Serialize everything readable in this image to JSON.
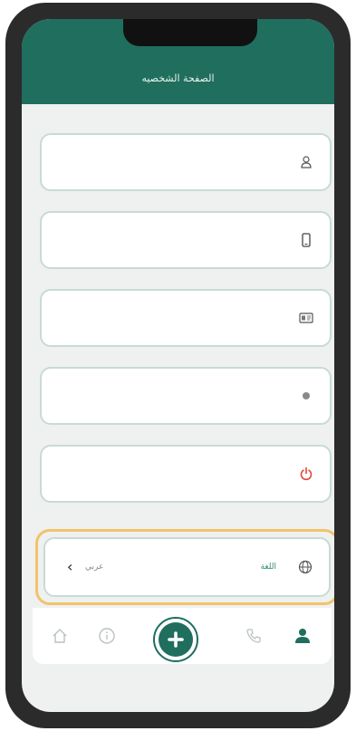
{
  "header": {
    "title": "الصفحة الشخصيه"
  },
  "fields": [
    {
      "icon": "user-icon"
    },
    {
      "icon": "phone-icon"
    },
    {
      "icon": "id-card-icon"
    },
    {
      "icon": "info-dot-icon"
    },
    {
      "icon": "power-icon"
    }
  ],
  "language": {
    "label": "اللغة",
    "value": "عربي",
    "icon": "globe-icon",
    "highlight_color": "#f2c36b"
  },
  "nav": {
    "items": [
      "home-icon",
      "info-icon",
      "add-icon",
      "call-icon",
      "profile-icon"
    ],
    "active": "profile-icon"
  },
  "colors": {
    "brand": "#1f6e5e",
    "logout": "#e0463b"
  }
}
